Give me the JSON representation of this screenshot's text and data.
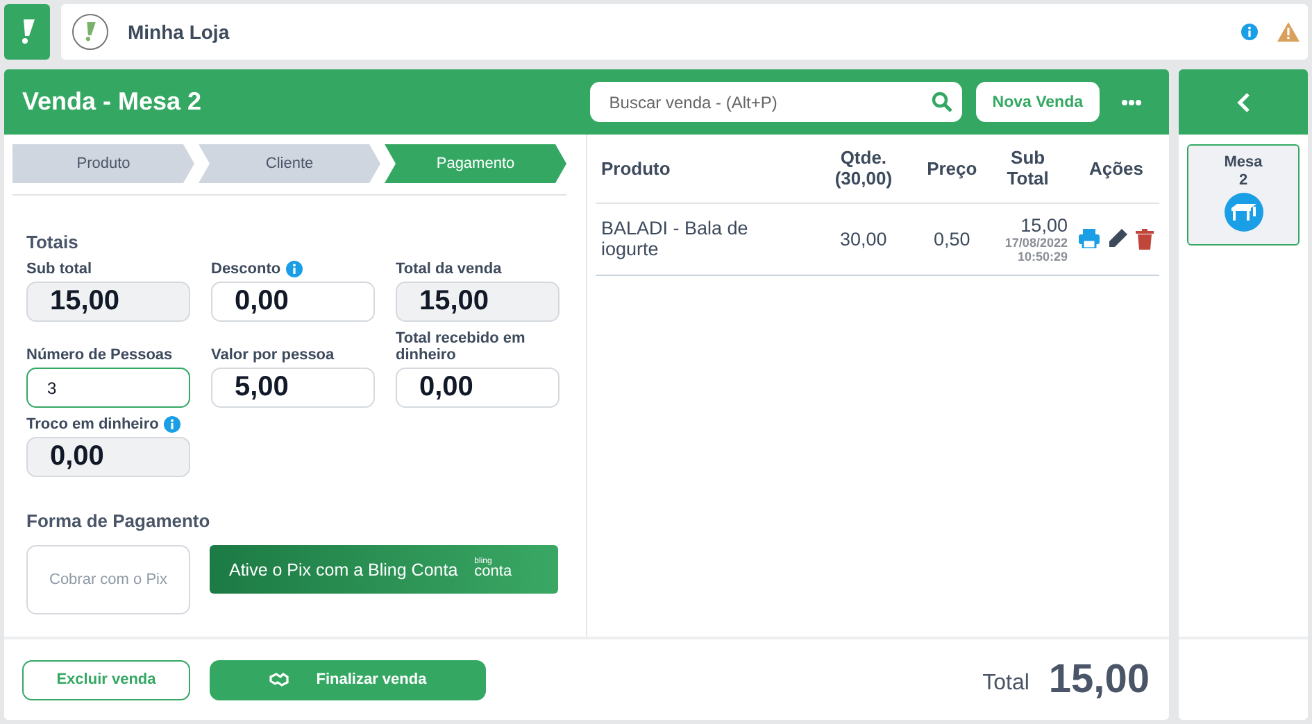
{
  "topbar": {
    "store_name": "Minha Loja"
  },
  "sale": {
    "title": "Venda - Mesa 2",
    "search": {
      "placeholder": "Buscar venda - (Alt+P)"
    },
    "new_button": "Nova Venda"
  },
  "steps": [
    {
      "label": "Produto",
      "selected": false
    },
    {
      "label": "Cliente",
      "selected": false
    },
    {
      "label": "Pagamento",
      "selected": true
    }
  ],
  "totals": {
    "heading": "Totais",
    "fields": [
      {
        "label": "Sub total",
        "value": "15,00",
        "kind": "readonly",
        "info": false
      },
      {
        "label": "Desconto",
        "value": "0,00",
        "kind": "input",
        "info": true
      },
      {
        "label": "Total da venda",
        "value": "15,00",
        "kind": "readonly",
        "info": false
      },
      {
        "label": "Número de Pessoas",
        "value": "3",
        "kind": "active",
        "info": false
      },
      {
        "label": "Valor por pessoa",
        "value": "5,00",
        "kind": "input",
        "info": false
      },
      {
        "label": "Total recebido em dinheiro",
        "value": "0,00",
        "kind": "input",
        "info": false
      },
      {
        "label": "Troco em dinheiro",
        "value": "0,00",
        "kind": "readonly",
        "info": true
      }
    ]
  },
  "payment": {
    "heading": "Forma de Pagamento",
    "pix_button": "Cobrar com o Pix",
    "pix_disabled": true,
    "promo": {
      "text": "Ative o Pix com a Bling Conta",
      "logo_top": "bling",
      "logo_bottom": "conta"
    }
  },
  "table": {
    "columns": [
      "Produto",
      "Qtde. (30,00)",
      "Preço",
      "Sub Total",
      "Ações"
    ],
    "rows": [
      {
        "product": "BALADI - Bala de iogurte",
        "quantity": "30,00",
        "price": "0,50",
        "subtotal": "15,00",
        "date": "17/08/2022",
        "time": "10:50:29"
      }
    ]
  },
  "footer": {
    "delete_button": "Excluir venda",
    "finish_button": "Finalizar venda",
    "total_label": "Total",
    "total_value": "15,00"
  },
  "tables_panel": [
    {
      "label": "Mesa",
      "number": "2",
      "selected": true
    }
  ]
}
